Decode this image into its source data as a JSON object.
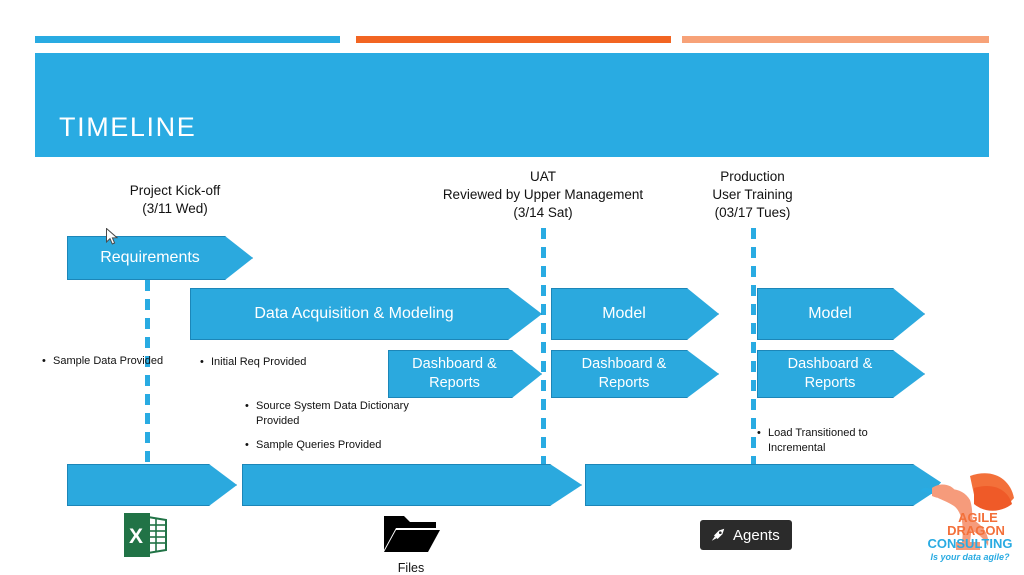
{
  "theme": {
    "blue": "#29ABE2",
    "blue_fill": "#2BA9DE",
    "blue_stroke": "#1C86B8",
    "orange": "#F26522",
    "peach": "#F7A278",
    "excel_green": "#217346",
    "badge_dark": "#2B2B2B",
    "logo_orange": "#F3703A",
    "logo_blue": "#29ABE2"
  },
  "accents": [
    {
      "name": "accent-bar-blue",
      "color": "#29ABE2"
    },
    {
      "name": "accent-bar-orange",
      "color": "#F26522"
    },
    {
      "name": "accent-bar-peach",
      "color": "#F7A278"
    }
  ],
  "header": {
    "title": "TIMELINE"
  },
  "milestones": [
    {
      "line1": "Project Kick-off",
      "line2": "(3/11 Wed)",
      "line3": ""
    },
    {
      "line1": "UAT",
      "line2": "Reviewed by Upper Management",
      "line3": "(3/14 Sat)"
    },
    {
      "line1": "Production",
      "line2": "User Training",
      "line3": "(03/17 Tues)"
    }
  ],
  "arrows": {
    "requirements": "Requirements",
    "data_acquisition": "Data Acquisition & Modeling",
    "model_uat": "Model",
    "model_prod": "Model",
    "dashboard_1_line1": "Dashboard &",
    "dashboard_1_line2": "Reports",
    "dashboard_2_line1": "Dashboard &",
    "dashboard_2_line2": "Reports",
    "dashboard_3_line1": "Dashboard &",
    "dashboard_3_line2": "Reports"
  },
  "bullets": {
    "group_a": [
      "Sample Data Provided"
    ],
    "group_b": [
      "Initial Req Provided"
    ],
    "group_c": [
      "Source System Data Dictionary Provided",
      "Sample Queries Provided"
    ],
    "group_d": [
      "Load Transitioned to Incremental"
    ],
    "marker": "•"
  },
  "assets": {
    "excel_icon_name": "excel-icon",
    "excel_letter": "X",
    "files_icon_name": "folder-icon",
    "files_caption": "Files",
    "agents_icon_name": "agents-rocket-icon",
    "agents_label": "Agents"
  },
  "logo": {
    "line1": "AGILE",
    "line2": "DRAGON",
    "line3": "CONSULTING",
    "tagline": "Is your data agile?"
  }
}
